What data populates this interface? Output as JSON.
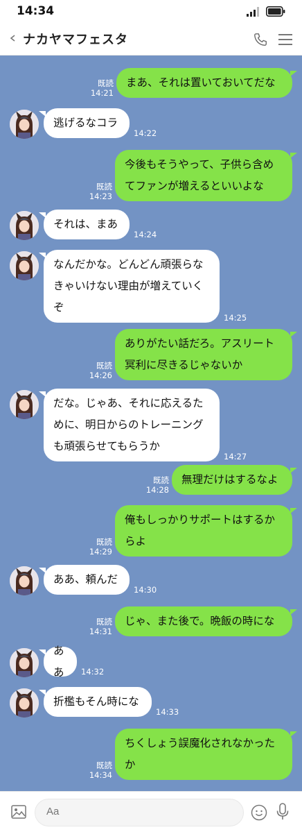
{
  "status_bar": {
    "time": "14:34"
  },
  "header": {
    "title": "ナカヤマフェスタ"
  },
  "read_label": "既読",
  "messages": [
    {
      "side": "right",
      "lines": [
        "まあ、それは置いておいてだな"
      ],
      "time": "14:21",
      "read": true
    },
    {
      "side": "left",
      "lines": [
        "逃げるなコラ"
      ],
      "time": "14:22"
    },
    {
      "side": "right",
      "lines": [
        "今後もそうやって、子供ら含め",
        "てファンが増えるといいよな"
      ],
      "time": "14:23",
      "read": true
    },
    {
      "side": "left",
      "lines": [
        "それは、まあ"
      ],
      "time": "14:24"
    },
    {
      "side": "left",
      "lines": [
        "なんだかな。どんどん頑張らな",
        "きゃいけない理由が増えていく",
        "ぞ"
      ],
      "time": "14:25"
    },
    {
      "side": "right",
      "lines": [
        "ありがたい話だろ。アスリート",
        "冥利に尽きるじゃないか"
      ],
      "time": "14:26",
      "read": true
    },
    {
      "side": "left",
      "lines": [
        "だな。じゃあ、それに応えるた",
        "めに、明日からのトレーニング",
        "も頑張らせてもらうか"
      ],
      "time": "14:27"
    },
    {
      "side": "right",
      "lines": [
        "無理だけはするなよ"
      ],
      "time": "14:28",
      "read": true
    },
    {
      "side": "right",
      "lines": [
        "俺もしっかりサポートはするか",
        "らよ"
      ],
      "time": "14:29",
      "read": true
    },
    {
      "side": "left",
      "lines": [
        "ああ、頼んだ"
      ],
      "time": "14:30"
    },
    {
      "side": "right",
      "lines": [
        "じゃ、また後で。晩飯の時にな"
      ],
      "time": "14:31",
      "read": true
    },
    {
      "side": "left",
      "lines": [
        "ああ"
      ],
      "time": "14:32"
    },
    {
      "side": "left",
      "lines": [
        "折檻もそん時にな"
      ],
      "time": "14:33"
    },
    {
      "side": "right",
      "lines": [
        "ちくしょう誤魔化されなかった",
        "か"
      ],
      "time": "14:34",
      "read": true
    }
  ],
  "input": {
    "placeholder": "Aa"
  },
  "icons": {
    "back": "chevron-left-icon",
    "phone": "phone-icon",
    "menu": "hamburger-menu-icon",
    "image": "image-icon",
    "emoji": "emoji-icon",
    "mic": "microphone-icon",
    "signal": "signal-icon",
    "battery": "battery-icon"
  },
  "colors": {
    "background": "#7393c4",
    "outgoing_bubble": "#85e249",
    "incoming_bubble": "#ffffff"
  }
}
